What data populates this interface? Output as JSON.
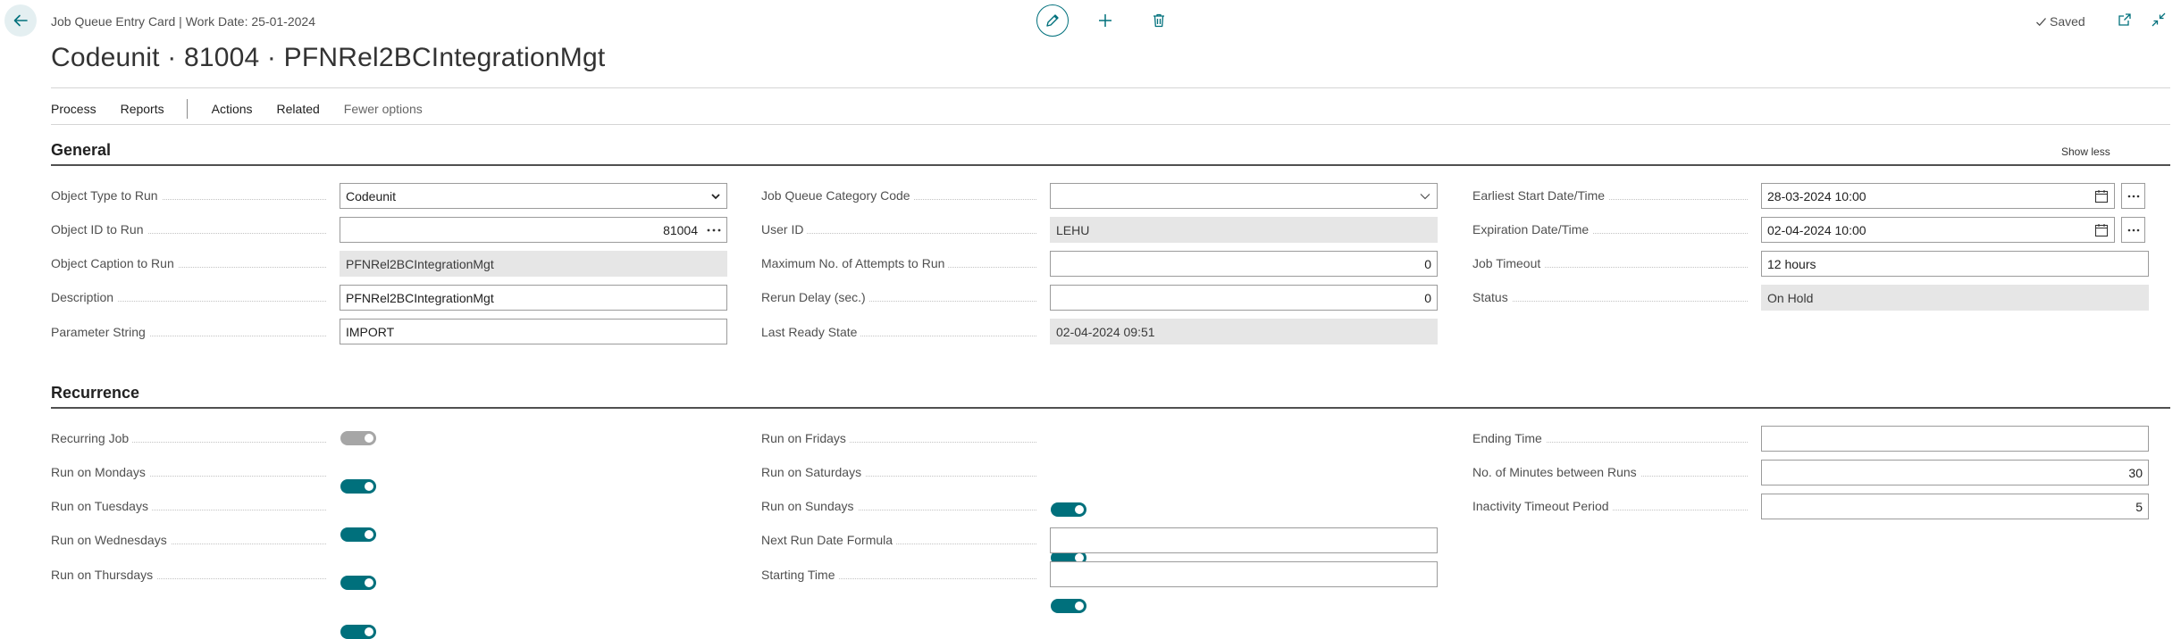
{
  "header": {
    "breadcrumb": "Job Queue Entry Card | Work Date: 25-01-2024",
    "title": "Codeunit · 81004 · PFNRel2BCIntegrationMgt",
    "saved_label": "Saved"
  },
  "actions": {
    "process": "Process",
    "reports": "Reports",
    "actions": "Actions",
    "related": "Related",
    "fewer_options": "Fewer options"
  },
  "general": {
    "title": "General",
    "show_less": "Show less",
    "object_type_label": "Object Type to Run",
    "object_type_value": "Codeunit",
    "object_id_label": "Object ID to Run",
    "object_id_value": "81004",
    "object_caption_label": "Object Caption to Run",
    "object_caption_value": "PFNRel2BCIntegrationMgt",
    "description_label": "Description",
    "description_value": "PFNRel2BCIntegrationMgt",
    "parameter_label": "Parameter String",
    "parameter_value": "IMPORT",
    "category_label": "Job Queue Category Code",
    "category_value": "",
    "user_id_label": "User ID",
    "user_id_value": "LEHU",
    "max_attempts_label": "Maximum No. of Attempts to Run",
    "max_attempts_value": "0",
    "rerun_delay_label": "Rerun Delay (sec.)",
    "rerun_delay_value": "0",
    "last_ready_label": "Last Ready State",
    "last_ready_value": "02-04-2024 09:51",
    "earliest_start_label": "Earliest Start Date/Time",
    "earliest_start_value": "28-03-2024 10:00",
    "expiration_label": "Expiration Date/Time",
    "expiration_value": "02-04-2024 10:00",
    "timeout_label": "Job Timeout",
    "timeout_value": "12 hours",
    "status_label": "Status",
    "status_value": "On Hold"
  },
  "recurrence": {
    "title": "Recurrence",
    "recurring_label": "Recurring Job",
    "recurring_on": false,
    "mondays_label": "Run on Mondays",
    "mondays_on": true,
    "tuesdays_label": "Run on Tuesdays",
    "tuesdays_on": true,
    "wednesdays_label": "Run on Wednesdays",
    "wednesdays_on": true,
    "thursdays_label": "Run on Thursdays",
    "thursdays_on": true,
    "fridays_label": "Run on Fridays",
    "fridays_on": true,
    "saturdays_label": "Run on Saturdays",
    "saturdays_on": true,
    "sundays_label": "Run on Sundays",
    "sundays_on": true,
    "next_run_formula_label": "Next Run Date Formula",
    "next_run_formula_value": "",
    "starting_time_label": "Starting Time",
    "starting_time_value": "",
    "ending_time_label": "Ending Time",
    "ending_time_value": "",
    "minutes_between_label": "No. of Minutes between Runs",
    "minutes_between_value": "30",
    "inactivity_label": "Inactivity Timeout Period",
    "inactivity_value": "5"
  },
  "colors": {
    "accent": "#00707c",
    "toggle_off": "#a6a6a6",
    "readonly_bg": "#e6e6e6"
  }
}
